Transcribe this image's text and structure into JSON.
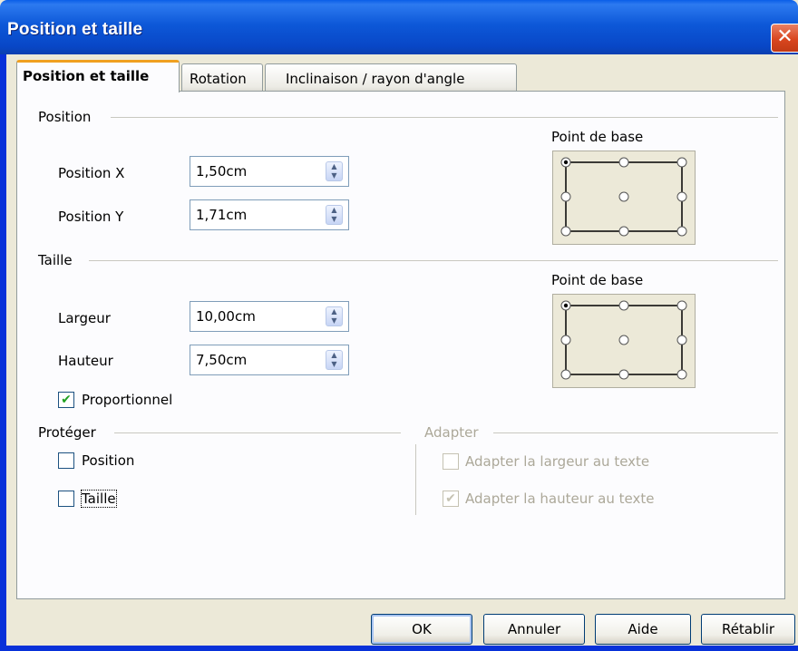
{
  "window": {
    "title": "Position et taille",
    "close_glyph": "✕"
  },
  "tabs": [
    {
      "label": "Position et taille",
      "active": true
    },
    {
      "label": "Rotation",
      "active": false
    },
    {
      "label": "Inclinaison / rayon d'angle",
      "active": false
    }
  ],
  "position_section": {
    "heading": "Position",
    "x_label": "Position X",
    "x_value": "1,50cm",
    "y_label": "Position Y",
    "y_value": "1,71cm",
    "base_point_label": "Point de base",
    "selected_point": "top-left"
  },
  "size_section": {
    "heading": "Taille",
    "width_label": "Largeur",
    "width_value": "10,00cm",
    "height_label": "Hauteur",
    "height_value": "7,50cm",
    "proportional_label": "Proportionnel",
    "proportional_checked": true,
    "base_point_label": "Point de base",
    "selected_point": "top-left"
  },
  "protect_section": {
    "heading": "Protéger",
    "position_label": "Position",
    "position_checked": false,
    "size_label": "Taille",
    "size_checked": false
  },
  "adapt_section": {
    "heading": "Adapter",
    "fit_width_label": "Adapter la largeur au texte",
    "fit_width_checked": false,
    "fit_height_label": "Adapter la hauteur au texte",
    "fit_height_checked": true,
    "enabled": false
  },
  "buttons": {
    "ok": "OK",
    "cancel": "Annuler",
    "help": "Aide",
    "reset": "Rétablir"
  },
  "colors": {
    "titlebar": "#0a5ee8",
    "tab_highlight": "#f0a020",
    "check_green": "#21a121"
  }
}
